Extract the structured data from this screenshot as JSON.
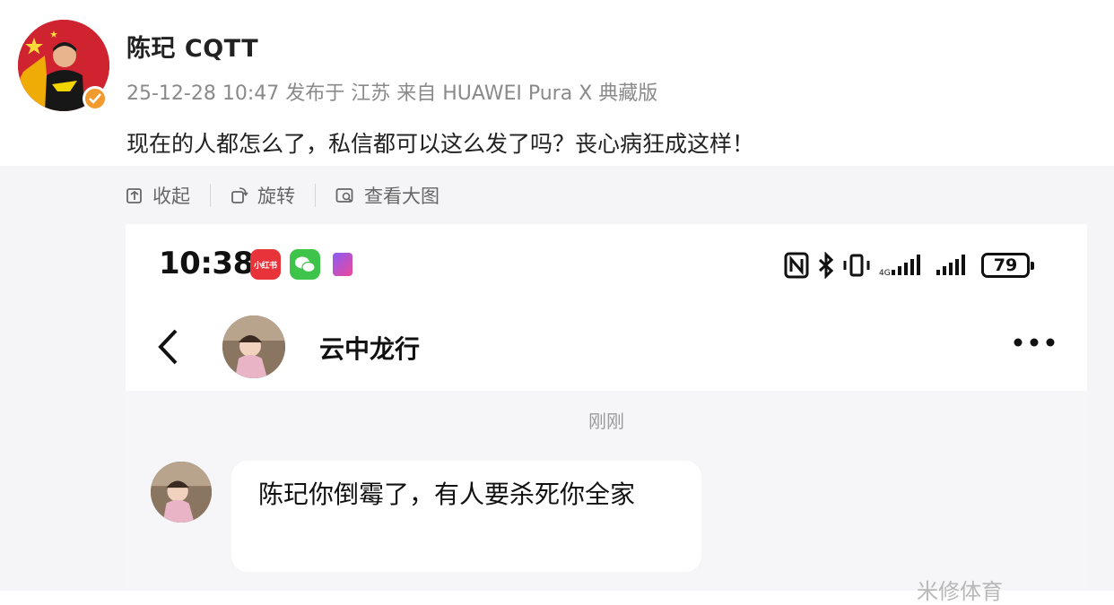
{
  "post": {
    "author": "陈玘 CQTT",
    "meta": "25-12-28 10:47 发布于 江苏 来自 HUAWEI Pura X 典藏版",
    "text": "现在的人都怎么了，私信都可以这么发了吗？丧心病狂成这样！"
  },
  "actions": [
    {
      "label": "收起",
      "icon": "collapse-icon"
    },
    {
      "label": "旋转",
      "icon": "rotate-icon"
    },
    {
      "label": "查看大图",
      "icon": "view-image-icon"
    }
  ],
  "screenshot": {
    "status_bar": {
      "time": "10:38",
      "app_icons": [
        "xiaohongshu-icon",
        "wechat-icon",
        "app-icon"
      ],
      "battery": "79"
    },
    "chat": {
      "contact_name": "云中龙行",
      "timestamp": "刚刚",
      "message": "陈玘你倒霉了，有人要杀死你全家"
    }
  },
  "watermark": "米修体育",
  "colors": {
    "verified_badge": "#f19a2e",
    "avatar_red": "#c8202a",
    "secondary_text": "#8a8a8a"
  }
}
